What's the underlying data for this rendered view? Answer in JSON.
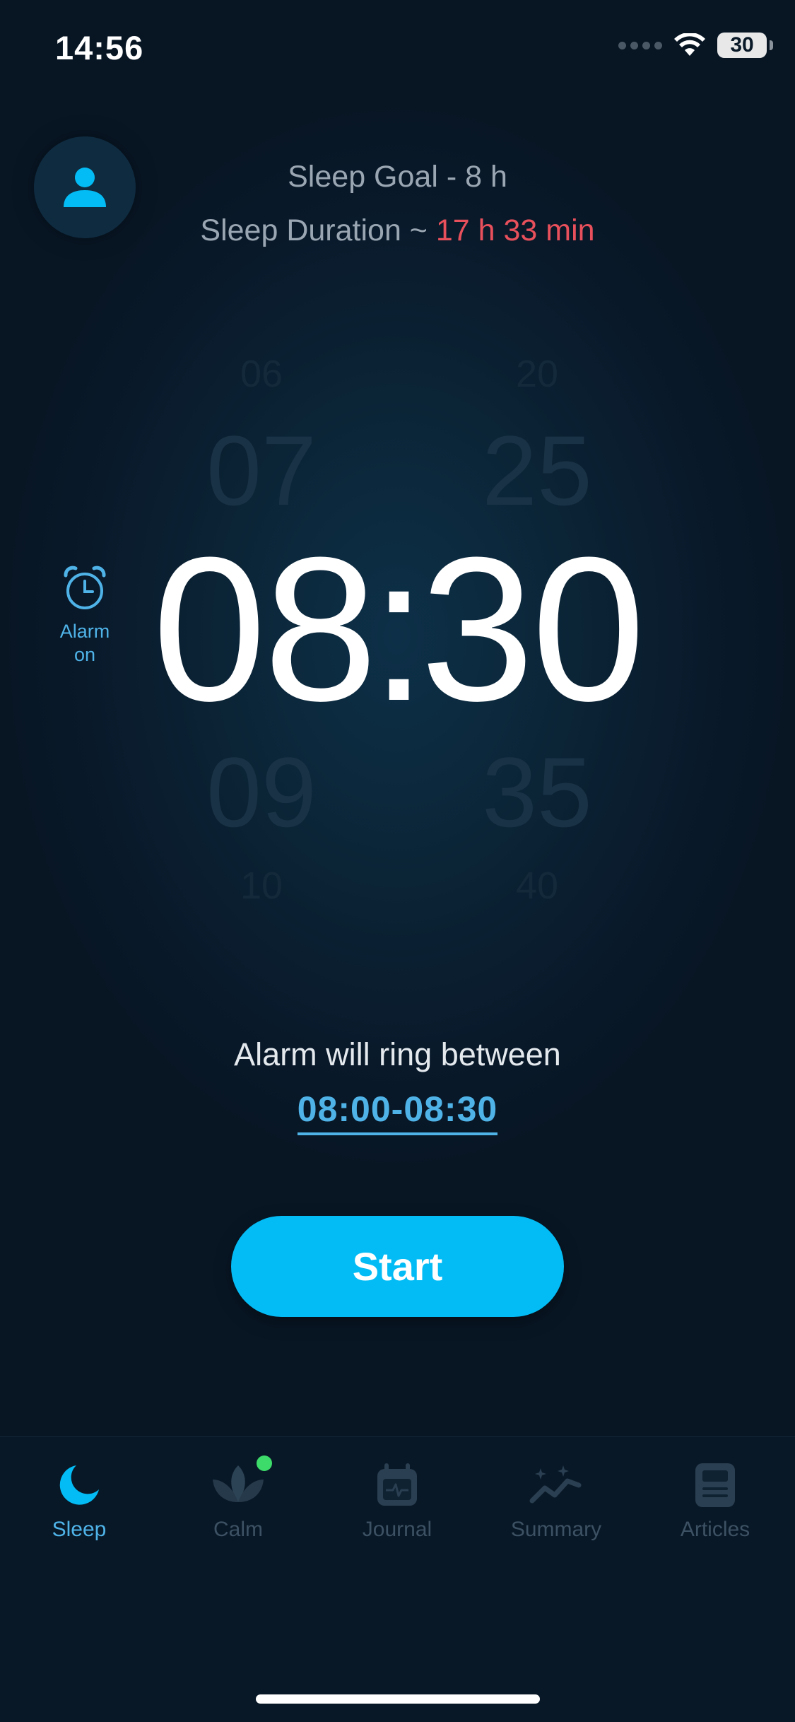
{
  "status_bar": {
    "time": "14:56",
    "battery": "30"
  },
  "header": {
    "goal": "Sleep Goal - 8 h",
    "duration_prefix": "Sleep Duration ~ ",
    "duration_value": "17 h 33 min",
    "duration_color": "#e8505b"
  },
  "picker": {
    "hour_far_above": "06",
    "hour_above": "07",
    "hour": "08",
    "hour_below": "09",
    "hour_far_below": "10",
    "minute_far_above": "20",
    "minute_above": "25",
    "minute": "30",
    "minute_below": "35",
    "minute_far_below": "40"
  },
  "alarm_toggle": {
    "icon": "alarm-clock-icon",
    "line1": "Alarm",
    "line2": "on"
  },
  "alarm_window": {
    "label": "Alarm will ring between",
    "range": "08:00-08:30"
  },
  "start_button": {
    "label": "Start",
    "color": "#04bcf5"
  },
  "tabs": [
    {
      "label": "Sleep",
      "icon": "moon-icon",
      "active": true
    },
    {
      "label": "Calm",
      "icon": "lotus-icon",
      "active": false,
      "badge": true
    },
    {
      "label": "Journal",
      "icon": "calendar-icon",
      "active": false
    },
    {
      "label": "Summary",
      "icon": "chart-icon",
      "active": false
    },
    {
      "label": "Articles",
      "icon": "article-icon",
      "active": false
    }
  ],
  "accent_color": "#4fb3e8"
}
